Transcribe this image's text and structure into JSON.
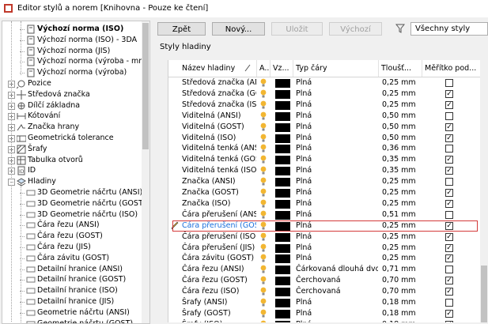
{
  "window": {
    "title": "Editor stylů a norem [Knihovna - Pouze ke čtení]"
  },
  "toolbar": {
    "back": "Zpět",
    "new": "Nový...",
    "save": "Uložit",
    "default": "Výchozí",
    "filter_value": "Všechny styly"
  },
  "section": {
    "title": "Styly hladiny"
  },
  "tree": {
    "items": [
      {
        "label": "Výchozí norma (ISO)",
        "icon": "doc-icon",
        "level": 2,
        "bold": true,
        "exp": ""
      },
      {
        "label": "Výchozí norma (ISO) - 3DA",
        "icon": "doc-icon",
        "level": 2,
        "exp": ""
      },
      {
        "label": "Výchozí norma (JIS)",
        "icon": "doc-icon",
        "level": 2,
        "exp": ""
      },
      {
        "label": "Výchozí norma (výroba - mm)",
        "icon": "doc-icon",
        "level": 2,
        "exp": ""
      },
      {
        "label": "Výchozí norma (výroba)",
        "icon": "doc-icon",
        "level": 2,
        "exp": ""
      },
      {
        "label": "Pozice",
        "icon": "balloon-icon",
        "level": 1,
        "exp": "+"
      },
      {
        "label": "Středová značka",
        "icon": "centermark-icon",
        "level": 1,
        "exp": "+"
      },
      {
        "label": "Dílčí základna",
        "icon": "datum-icon",
        "level": 1,
        "exp": "+"
      },
      {
        "label": "Kótování",
        "icon": "dimension-icon",
        "level": 1,
        "exp": "+"
      },
      {
        "label": "Značka hrany",
        "icon": "edge-icon",
        "level": 1,
        "exp": "+"
      },
      {
        "label": "Geometrická tolerance",
        "icon": "tolerance-icon",
        "level": 1,
        "exp": "+"
      },
      {
        "label": "Šrafy",
        "icon": "hatch-icon",
        "level": 1,
        "exp": "+"
      },
      {
        "label": "Tabulka otvorů",
        "icon": "table-icon",
        "level": 1,
        "exp": "+"
      },
      {
        "label": "ID",
        "icon": "id-icon",
        "level": 1,
        "exp": "+"
      },
      {
        "label": "Hladiny",
        "icon": "layers-icon",
        "level": 1,
        "exp": "-"
      },
      {
        "label": "3D Geometrie náčrtu (ANSI)",
        "icon": "layer-icon",
        "level": 2,
        "exp": ""
      },
      {
        "label": "3D Geometrie náčrtu (GOST)",
        "icon": "layer-icon",
        "level": 2,
        "exp": ""
      },
      {
        "label": "3D Geometrie náčrtu (ISO)",
        "icon": "layer-icon",
        "level": 2,
        "exp": ""
      },
      {
        "label": "Čára řezu (ANSI)",
        "icon": "layer-icon",
        "level": 2,
        "exp": ""
      },
      {
        "label": "Čára řezu (GOST)",
        "icon": "layer-icon",
        "level": 2,
        "exp": ""
      },
      {
        "label": "Čára řezu (JIS)",
        "icon": "layer-icon",
        "level": 2,
        "exp": ""
      },
      {
        "label": "Čára závitu (GOST)",
        "icon": "layer-icon",
        "level": 2,
        "exp": ""
      },
      {
        "label": "Detailní hranice (ANSI)",
        "icon": "layer-icon",
        "level": 2,
        "exp": ""
      },
      {
        "label": "Detailní hranice (GOST)",
        "icon": "layer-icon",
        "level": 2,
        "exp": ""
      },
      {
        "label": "Detailní hranice (ISO)",
        "icon": "layer-icon",
        "level": 2,
        "exp": ""
      },
      {
        "label": "Detailní hranice (JIS)",
        "icon": "layer-icon",
        "level": 2,
        "exp": ""
      },
      {
        "label": "Geometrie náčrtu (ANSI)",
        "icon": "layer-icon",
        "level": 2,
        "exp": ""
      },
      {
        "label": "Geometrie náčrtu (GOST)",
        "icon": "layer-icon",
        "level": 2,
        "exp": ""
      }
    ]
  },
  "grid": {
    "columns": [
      "Název hladiny",
      "A...",
      "Vz...",
      "Typ čáry",
      "Tloušť...",
      "Měřítko pod..."
    ],
    "selected_index": 13,
    "rows": [
      {
        "name": "Středová značka (ANSI)",
        "type": "Plná",
        "width": "0,25 mm",
        "scale": false
      },
      {
        "name": "Středová značka (GOST)",
        "type": "Plná",
        "width": "0,25 mm",
        "scale": true
      },
      {
        "name": "Středová značka (ISO)",
        "type": "Plná",
        "width": "0,25 mm",
        "scale": true
      },
      {
        "name": "Viditelná (ANSI)",
        "type": "Plná",
        "width": "0,50 mm",
        "scale": false
      },
      {
        "name": "Viditelná (GOST)",
        "type": "Plná",
        "width": "0,50 mm",
        "scale": true
      },
      {
        "name": "Viditelná (ISO)",
        "type": "Plná",
        "width": "0,50 mm",
        "scale": true
      },
      {
        "name": "Viditelná tenká (ANSI)",
        "type": "Plná",
        "width": "0,36 mm",
        "scale": false
      },
      {
        "name": "Viditelná tenká (GOST)",
        "type": "Plná",
        "width": "0,35 mm",
        "scale": true
      },
      {
        "name": "Viditelná tenká (ISO)",
        "type": "Plná",
        "width": "0,35 mm",
        "scale": true
      },
      {
        "name": "Značka (ANSI)",
        "type": "Plná",
        "width": "0,25 mm",
        "scale": false
      },
      {
        "name": "Značka (GOST)",
        "type": "Plná",
        "width": "0,25 mm",
        "scale": true
      },
      {
        "name": "Značka (ISO)",
        "type": "Plná",
        "width": "0,25 mm",
        "scale": true
      },
      {
        "name": "Čára přerušení (ANSI)",
        "type": "Plná",
        "width": "0,51 mm",
        "scale": false
      },
      {
        "name": "Čára přerušení (GOST)",
        "type": "Plná",
        "width": "0,25 mm",
        "scale": true
      },
      {
        "name": "Čára přerušení (ISO)",
        "type": "Plná",
        "width": "0,25 mm",
        "scale": true
      },
      {
        "name": "Čára přerušení (JIS)",
        "type": "Plná",
        "width": "0,25 mm",
        "scale": true
      },
      {
        "name": "Čára závitu (GOST)",
        "type": "Plná",
        "width": "0,25 mm",
        "scale": true
      },
      {
        "name": "Čára řezu (ANSI)",
        "type": "Čárkovaná dlouhá dvojtečka",
        "width": "0,71 mm",
        "scale": false
      },
      {
        "name": "Čára řezu (GOST)",
        "type": "Čerchovaná",
        "width": "0,70 mm",
        "scale": true
      },
      {
        "name": "Čára řezu (ISO)",
        "type": "Čerchovaná",
        "width": "0,70 mm",
        "scale": true
      },
      {
        "name": "Šrafy (ANSI)",
        "type": "Plná",
        "width": "0,18 mm",
        "scale": false
      },
      {
        "name": "Šrafy (GOST)",
        "type": "Plná",
        "width": "0,18 mm",
        "scale": true
      },
      {
        "name": "Šrafy (ISO)",
        "type": "Plná",
        "width": "0,18 mm",
        "scale": true
      }
    ]
  },
  "colors": {
    "selection_border": "#d43a3a",
    "selected_text": "#1a6fdb",
    "bulb": "#f2b632"
  }
}
